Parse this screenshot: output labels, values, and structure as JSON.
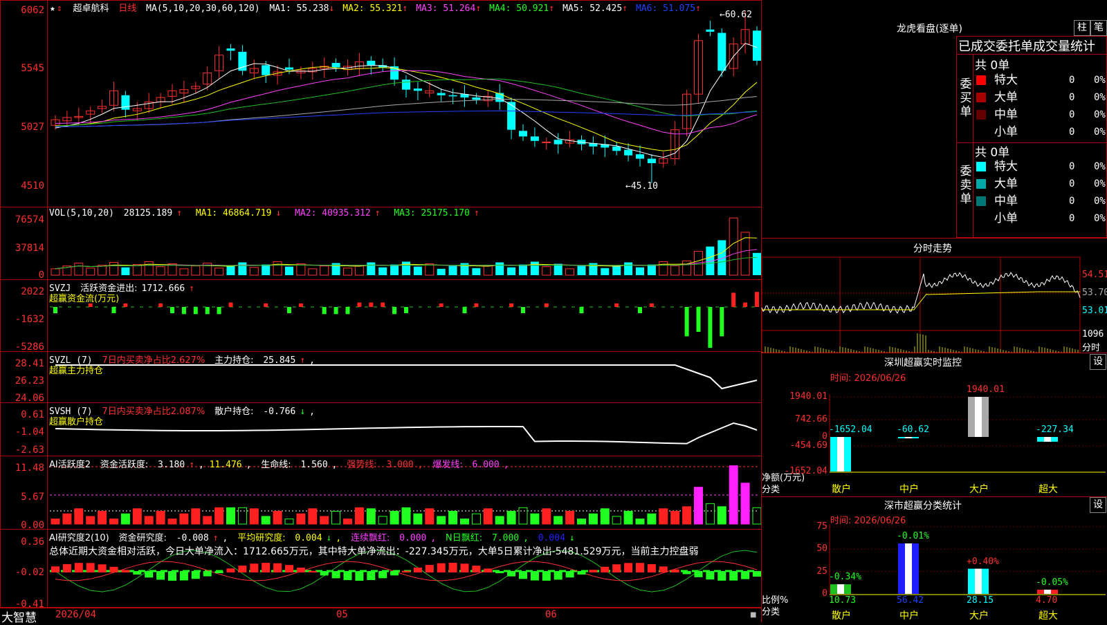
{
  "stock": {
    "name": "超卓航科",
    "period": "日线",
    "ma_label": "MA(5,10,20,30,60,120)",
    "ma": [
      {
        "k": "MA1:",
        "v": "55.238",
        "a": "↓",
        "c": "#ffffff"
      },
      {
        "k": "MA2:",
        "v": "55.321",
        "a": "↑",
        "c": "#ffff00"
      },
      {
        "k": "MA3:",
        "v": "51.264",
        "a": "↑",
        "c": "#ff40ff"
      },
      {
        "k": "MA4:",
        "v": "50.921",
        "a": "↑",
        "c": "#20ff20"
      },
      {
        "k": "MA5:",
        "v": "52.425",
        "a": "↑",
        "c": "#ffffff"
      },
      {
        "k": "MA6:",
        "v": "51.075",
        "a": "↑",
        "c": "#2040ff"
      }
    ],
    "high_mark": "60.62",
    "low_mark": "45.10",
    "yticks": [
      "6062",
      "5545",
      "5027",
      "4510"
    ]
  },
  "vol": {
    "label": "VOL(5,10,20)",
    "value": "28125.189",
    "a": "↑",
    "ma1": "46864.719",
    "ma1a": "↓",
    "ma2": "40935.312",
    "ma2a": "↑",
    "ma3": "25175.170",
    "ma3a": "↑",
    "yticks": [
      "76574",
      "37814",
      "0"
    ]
  },
  "svzj": {
    "label": "SVZJ",
    "title": "活跃资金进出:",
    "value": "1712.666",
    "a": "↑",
    "sub": "超赢资金流(万元)",
    "yticks": [
      "2022",
      "-1632",
      "-5286"
    ]
  },
  "svzl": {
    "label": "SVZL (7)",
    "title": "7日内买卖净占比2.627%",
    "k": "主力持仓:",
    "value": "25.845",
    "a": "↑",
    "sub": "超赢主力持仓",
    "yticks": [
      "28.41",
      "26.23",
      "24.06"
    ]
  },
  "svsh": {
    "label": "SVSH (7)",
    "title": "7日内买卖净占比2.087%",
    "k": "散户持仓:",
    "value": "-0.766",
    "a": "↓",
    "sub": "超赢散户持仓",
    "yticks": [
      "0.61",
      "-1.04",
      "-2.63"
    ]
  },
  "ai1": {
    "label": "AI活跃度2",
    "k1": "资金活跃度:",
    "v1": "3.180",
    "a1": "↑",
    "v2": "11.476",
    "k3": "生命线:",
    "v3": "1.560",
    "k4": "强势线:",
    "v4": "3.000",
    "k5": "爆发线:",
    "v5": "6.000",
    "yticks": [
      "11.48",
      "5.67",
      "0.00"
    ]
  },
  "ai2": {
    "label": "AI研究度2(10)",
    "k1": "资金研究度:",
    "v1": "-0.008",
    "a1": "↑",
    "k2": "平均研究度:",
    "v2": "0.004",
    "a2": "↓",
    "k3": "连续飘红:",
    "v3": "0.000",
    "k4": "N日飘红:",
    "v4": "7.000",
    "v5": "0.004",
    "a5": "↓",
    "summary": "总体近期大资金相对活跃，今日大单净流入：1712.665万元，其中特大单净流出：-227.345万元，大单5日累计净出-5481.529万元，当前主力控盘弱",
    "yticks": [
      "0.36",
      "-0.02",
      "-0.41"
    ]
  },
  "footer": {
    "brand": "大智慧",
    "d1": "2026/04",
    "d2": "05",
    "d3": "06"
  },
  "lhb": {
    "title": "龙虎看盘(逐单)",
    "btn1": "柱",
    "btn2": "笔",
    "stat_title": "已成交委托单成交量统计",
    "buy_label": "委买单",
    "sell_label": "委卖单",
    "buy_total": "共 0单",
    "sell_total": "共 0单",
    "rows": [
      {
        "name": "特大",
        "n": "0",
        "p": "0%"
      },
      {
        "name": "大单",
        "n": "0",
        "p": "0%"
      },
      {
        "name": "中单",
        "n": "0",
        "p": "0%"
      },
      {
        "name": "小单",
        "n": "0",
        "p": "0%"
      }
    ],
    "buy_colors": [
      "#ff0000",
      "#aa0000",
      "#660000",
      ""
    ],
    "sell_colors": [
      "#00ffff",
      "#00aaaa",
      "#007777",
      ""
    ]
  },
  "intraday": {
    "title": "分时走势",
    "p1": "54.51",
    "p2": "53.70",
    "p3": "53.01",
    "v": "1096",
    "v2": "分时"
  },
  "sz_monitor": {
    "title": "深圳超赢实时监控",
    "btn": "设",
    "date": "时间: 2026/06/26",
    "yticks": [
      "1940.01",
      "742.66",
      "0",
      "-454.69",
      "-1652.04"
    ],
    "ylabel": "净额(万元)",
    "xlabel": "分类",
    "cats": [
      "散户",
      "中户",
      "大户",
      "超大"
    ],
    "values": [
      -1652.04,
      -60.62,
      1940.01,
      -227.34
    ],
    "value_labels": [
      "-1652.04",
      "-60.62",
      "1940.01",
      "-227.34"
    ]
  },
  "sz_class": {
    "title": "深市超赢分类统计",
    "btn": "设",
    "date": "时间: 2026/06/26",
    "yticks": [
      "75",
      "50",
      "25",
      "0"
    ],
    "ylabel": "比例%",
    "xlabel": "分类",
    "cats": [
      "散户",
      "中户",
      "大户",
      "超大"
    ],
    "values": [
      10.73,
      56.42,
      28.15,
      4.7
    ],
    "value_labels": [
      "10.73",
      "56.42",
      "28.15",
      "4.70"
    ],
    "changes": [
      "-0.34%",
      "-0.01%",
      "+0.40%",
      "-0.05%"
    ]
  }
}
